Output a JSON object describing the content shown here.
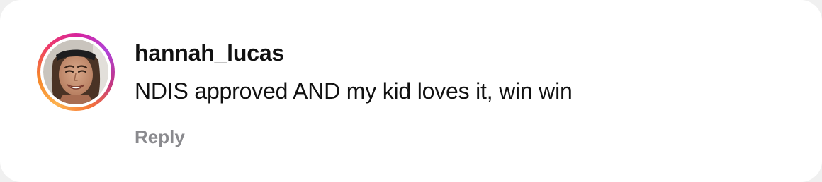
{
  "comment": {
    "username": "hannah_lucas",
    "text": "NDIS approved AND my kid loves it, win win",
    "reply_label": "Reply"
  },
  "avatar": {
    "ring_colors": [
      "#fdb24f",
      "#f58529",
      "#ee3b6a",
      "#d6249f",
      "#b042d8"
    ],
    "icon": "user-avatar-photo"
  },
  "colors": {
    "text_primary": "#111111",
    "text_secondary": "#8a8a8e",
    "background": "#ffffff"
  }
}
